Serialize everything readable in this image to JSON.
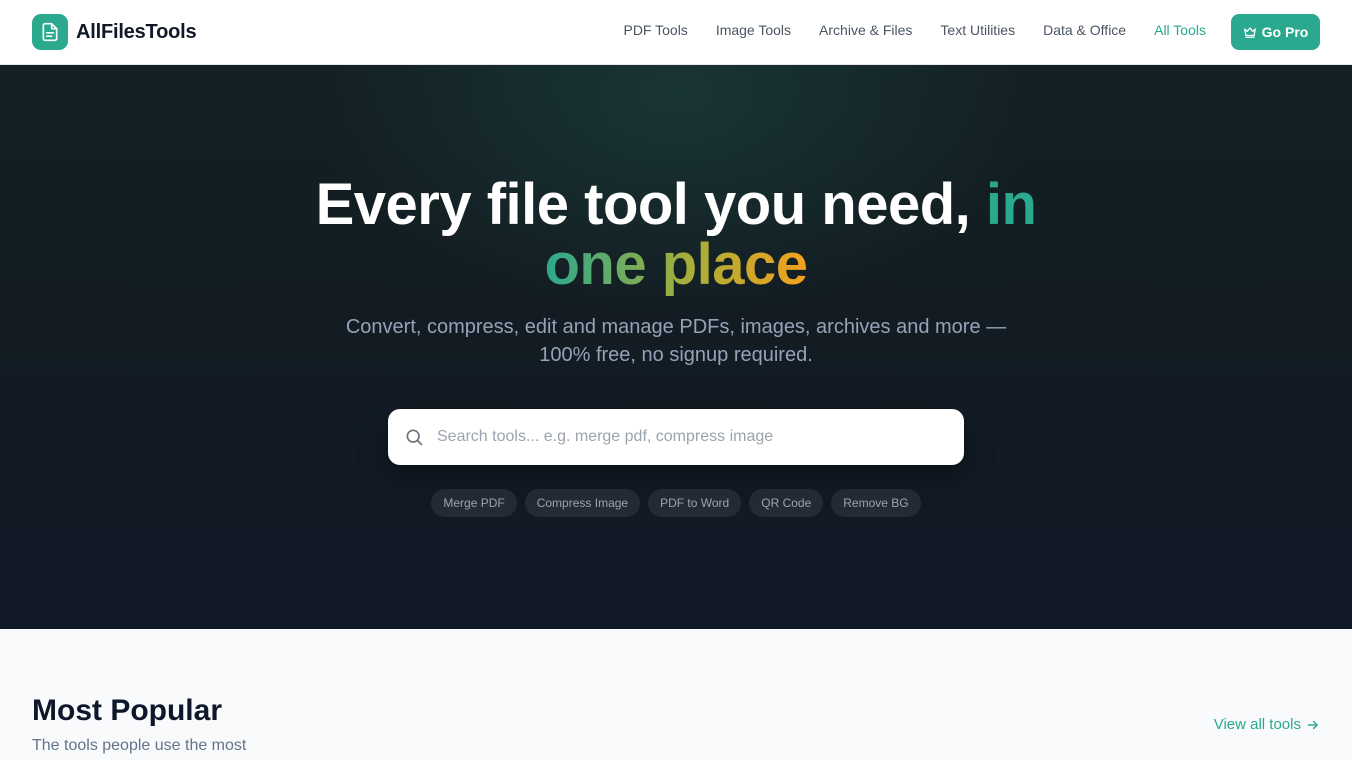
{
  "header": {
    "brand": "AllFilesTools",
    "nav": [
      {
        "label": "PDF Tools",
        "active": false
      },
      {
        "label": "Image Tools",
        "active": false
      },
      {
        "label": "Archive & Files",
        "active": false
      },
      {
        "label": "Text Utilities",
        "active": false
      },
      {
        "label": "Data & Office",
        "active": false
      },
      {
        "label": "All Tools",
        "active": true
      }
    ],
    "cta_label": "Go Pro",
    "cta_icon": "crown-icon",
    "logo_icon": "document-icon"
  },
  "hero": {
    "title_main": "Every file tool you need, ",
    "title_highlight": "in",
    "title_gradient": "one place",
    "subtitle": "Convert, compress, edit and manage PDFs, images, archives and more — 100% free, no signup required.",
    "search_placeholder": "Search tools... e.g. merge pdf, compress image",
    "search_value": "",
    "search_icon": "search-icon",
    "quick_links": [
      "Merge PDF",
      "Compress Image",
      "PDF to Word",
      "QR Code",
      "Remove BG"
    ]
  },
  "popular": {
    "title": "Most Popular",
    "subtitle": "The tools people use the most",
    "view_all_label": "View all tools",
    "view_all_icon": "arrow-right-icon"
  },
  "colors": {
    "accent": "#2aa98e",
    "gradient_start": "#2aa98e",
    "gradient_end": "#f4a11c",
    "hero_bg": "#111827"
  }
}
